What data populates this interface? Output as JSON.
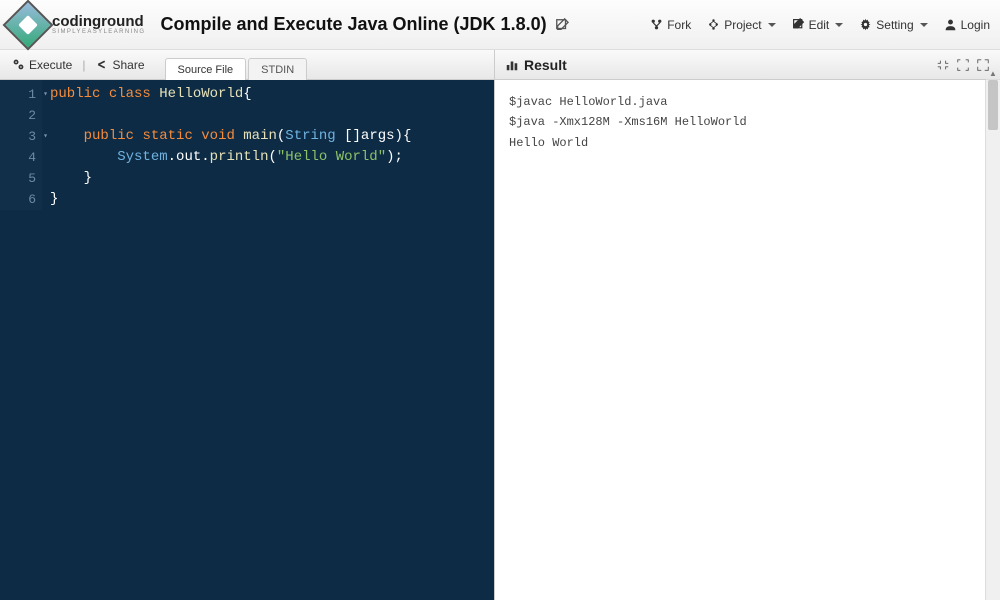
{
  "header": {
    "logo_main": "codinground",
    "logo_sub": "SIMPLYEASYLEARNING",
    "title": "Compile and Execute Java Online (JDK 1.8.0)"
  },
  "nav": {
    "fork": "Fork",
    "project": "Project",
    "edit": "Edit",
    "setting": "Setting",
    "login": "Login"
  },
  "toolbar": {
    "execute": "Execute",
    "share": "Share",
    "tabs": {
      "source": "Source File",
      "stdin": "STDIN"
    }
  },
  "result": {
    "title": "Result",
    "lines": {
      "l1": "$javac HelloWorld.java",
      "l2": "$java -Xmx128M -Xms16M HelloWorld",
      "l3": "Hello World"
    }
  },
  "editor": {
    "line_numbers": {
      "n1": "1",
      "n2": "2",
      "n3": "3",
      "n4": "4",
      "n5": "5",
      "n6": "6"
    },
    "tokens": {
      "public": "public",
      "class": "class",
      "helloworld": "HelloWorld",
      "static": "static",
      "void": "void",
      "main": "main",
      "string": "String",
      "args": "[]args",
      "system": "System",
      "out": "out",
      "println": "println",
      "hello": "\"Hello World\"",
      "ob": "{",
      "cb": "}",
      "op": "(",
      "cp": ")",
      "sc": ";",
      "dot": "."
    }
  }
}
